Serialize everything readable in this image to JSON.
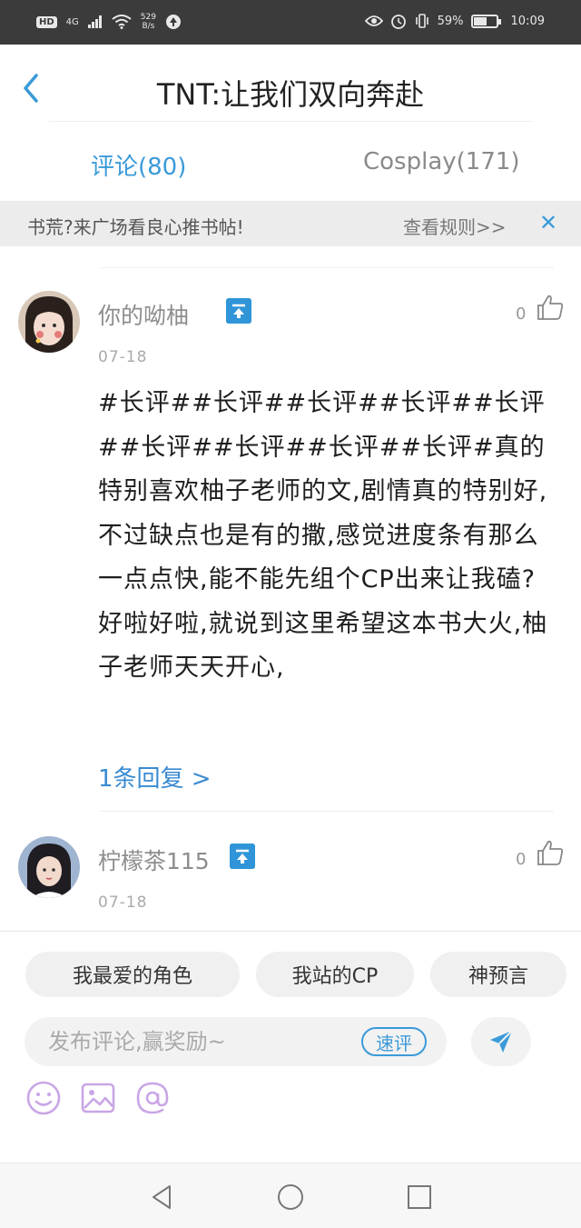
{
  "status_bar": {
    "network": "4G",
    "speed_value": "529",
    "speed_unit": "B/s",
    "battery": "59%",
    "battery_level": 0.59,
    "time": "10:09"
  },
  "header": {
    "title": "TNT:让我们双向奔赴"
  },
  "tabs": [
    {
      "label": "评论(80)",
      "active": true
    },
    {
      "label": "Cosplay(171)",
      "active": false
    }
  ],
  "banner": {
    "text": "书荒?来广场看良心推书帖!",
    "rules_link": "查看规则>>",
    "close": "✕"
  },
  "comments": [
    {
      "username": "你的呦柚",
      "date": "07-18",
      "likes": "0",
      "body": "#长评##长评##长评##长评##长评##长评##长评##长评##长评#真的特别喜欢柚子老师的文,剧情真的特别好,不过缺点也是有的撒,感觉进度条有那么一点点快,能不能先组个CP出来让我磕?好啦好啦,就说到这里希望这本书大火,柚子老师天天开心,",
      "replies": "1条回复 >"
    },
    {
      "username": "柠檬茶115",
      "date": "07-18",
      "likes": "0"
    }
  ],
  "quick_tags": [
    "我最爱的角色",
    "我站的CP",
    "神预言"
  ],
  "composer": {
    "placeholder": "发布评论,赢奖励~",
    "quick_review": "速评"
  },
  "colors": {
    "accent": "#3a9ad9",
    "status_bar": "#3b3b3b",
    "banner_bg": "#ececec",
    "reply_link": "#3a8bd1",
    "emoji_icons": "#c9a6e6"
  }
}
